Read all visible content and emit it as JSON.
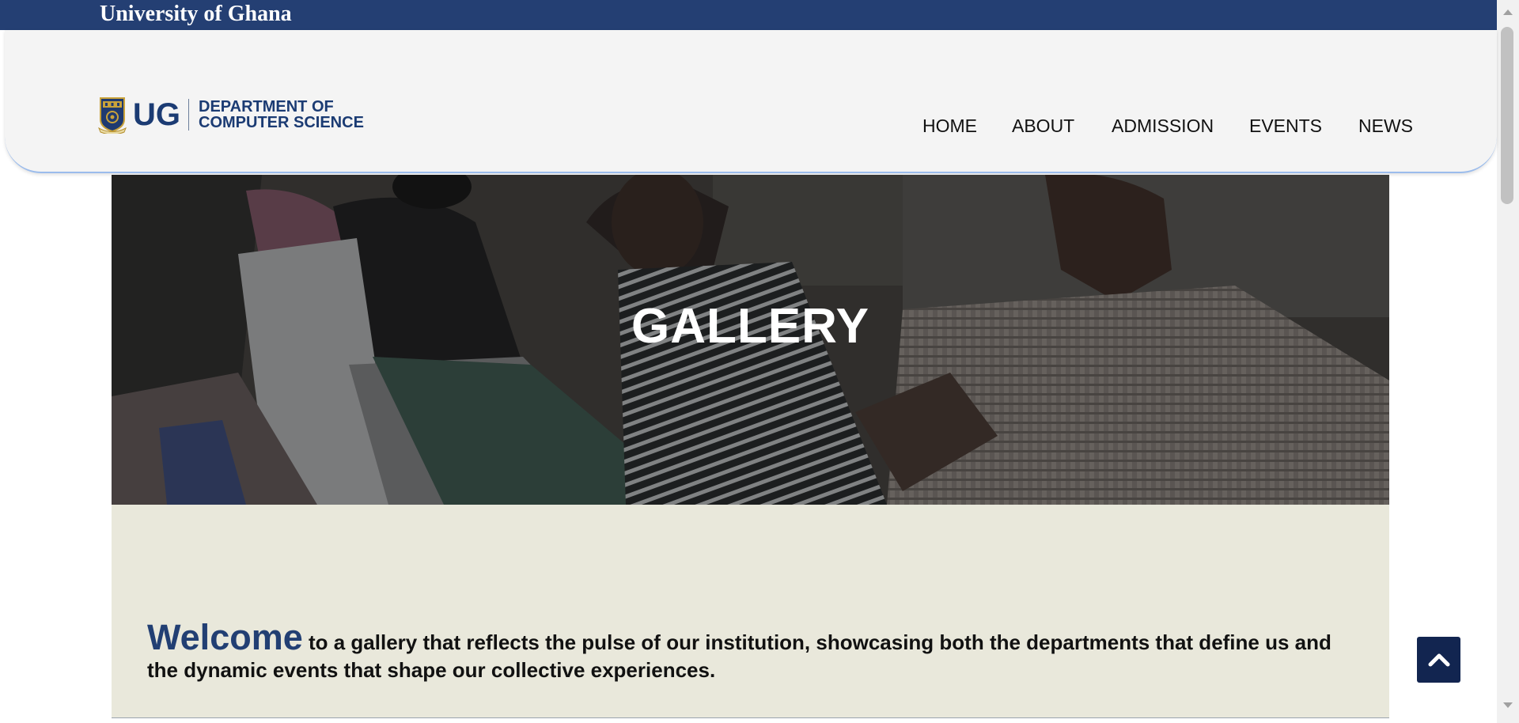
{
  "topbar": {
    "title": "University of Ghana"
  },
  "logo": {
    "short": "UG",
    "department": "DEPARTMENT OF\nCOMPUTER SCIENCE"
  },
  "nav": {
    "items": [
      {
        "label": "HOME"
      },
      {
        "label": "ABOUT"
      },
      {
        "label": "ADMISSION"
      },
      {
        "label": "EVENTS"
      },
      {
        "label": "NEWS"
      }
    ]
  },
  "hero": {
    "title": "GALLERY"
  },
  "welcome": {
    "lead": "Welcome",
    "text": " to a gallery that reflects the pulse of our institution, showcasing both the departments that define us and the dynamic events that shape our collective experiences."
  },
  "icons": {
    "back_to_top": "chevron-up-icon",
    "crest": "ug-crest-icon"
  },
  "colors": {
    "topbar": "#243f73",
    "brand": "#1b3b73",
    "welcome_bg": "#e9e8db",
    "back_to_top_bg": "#122550"
  }
}
